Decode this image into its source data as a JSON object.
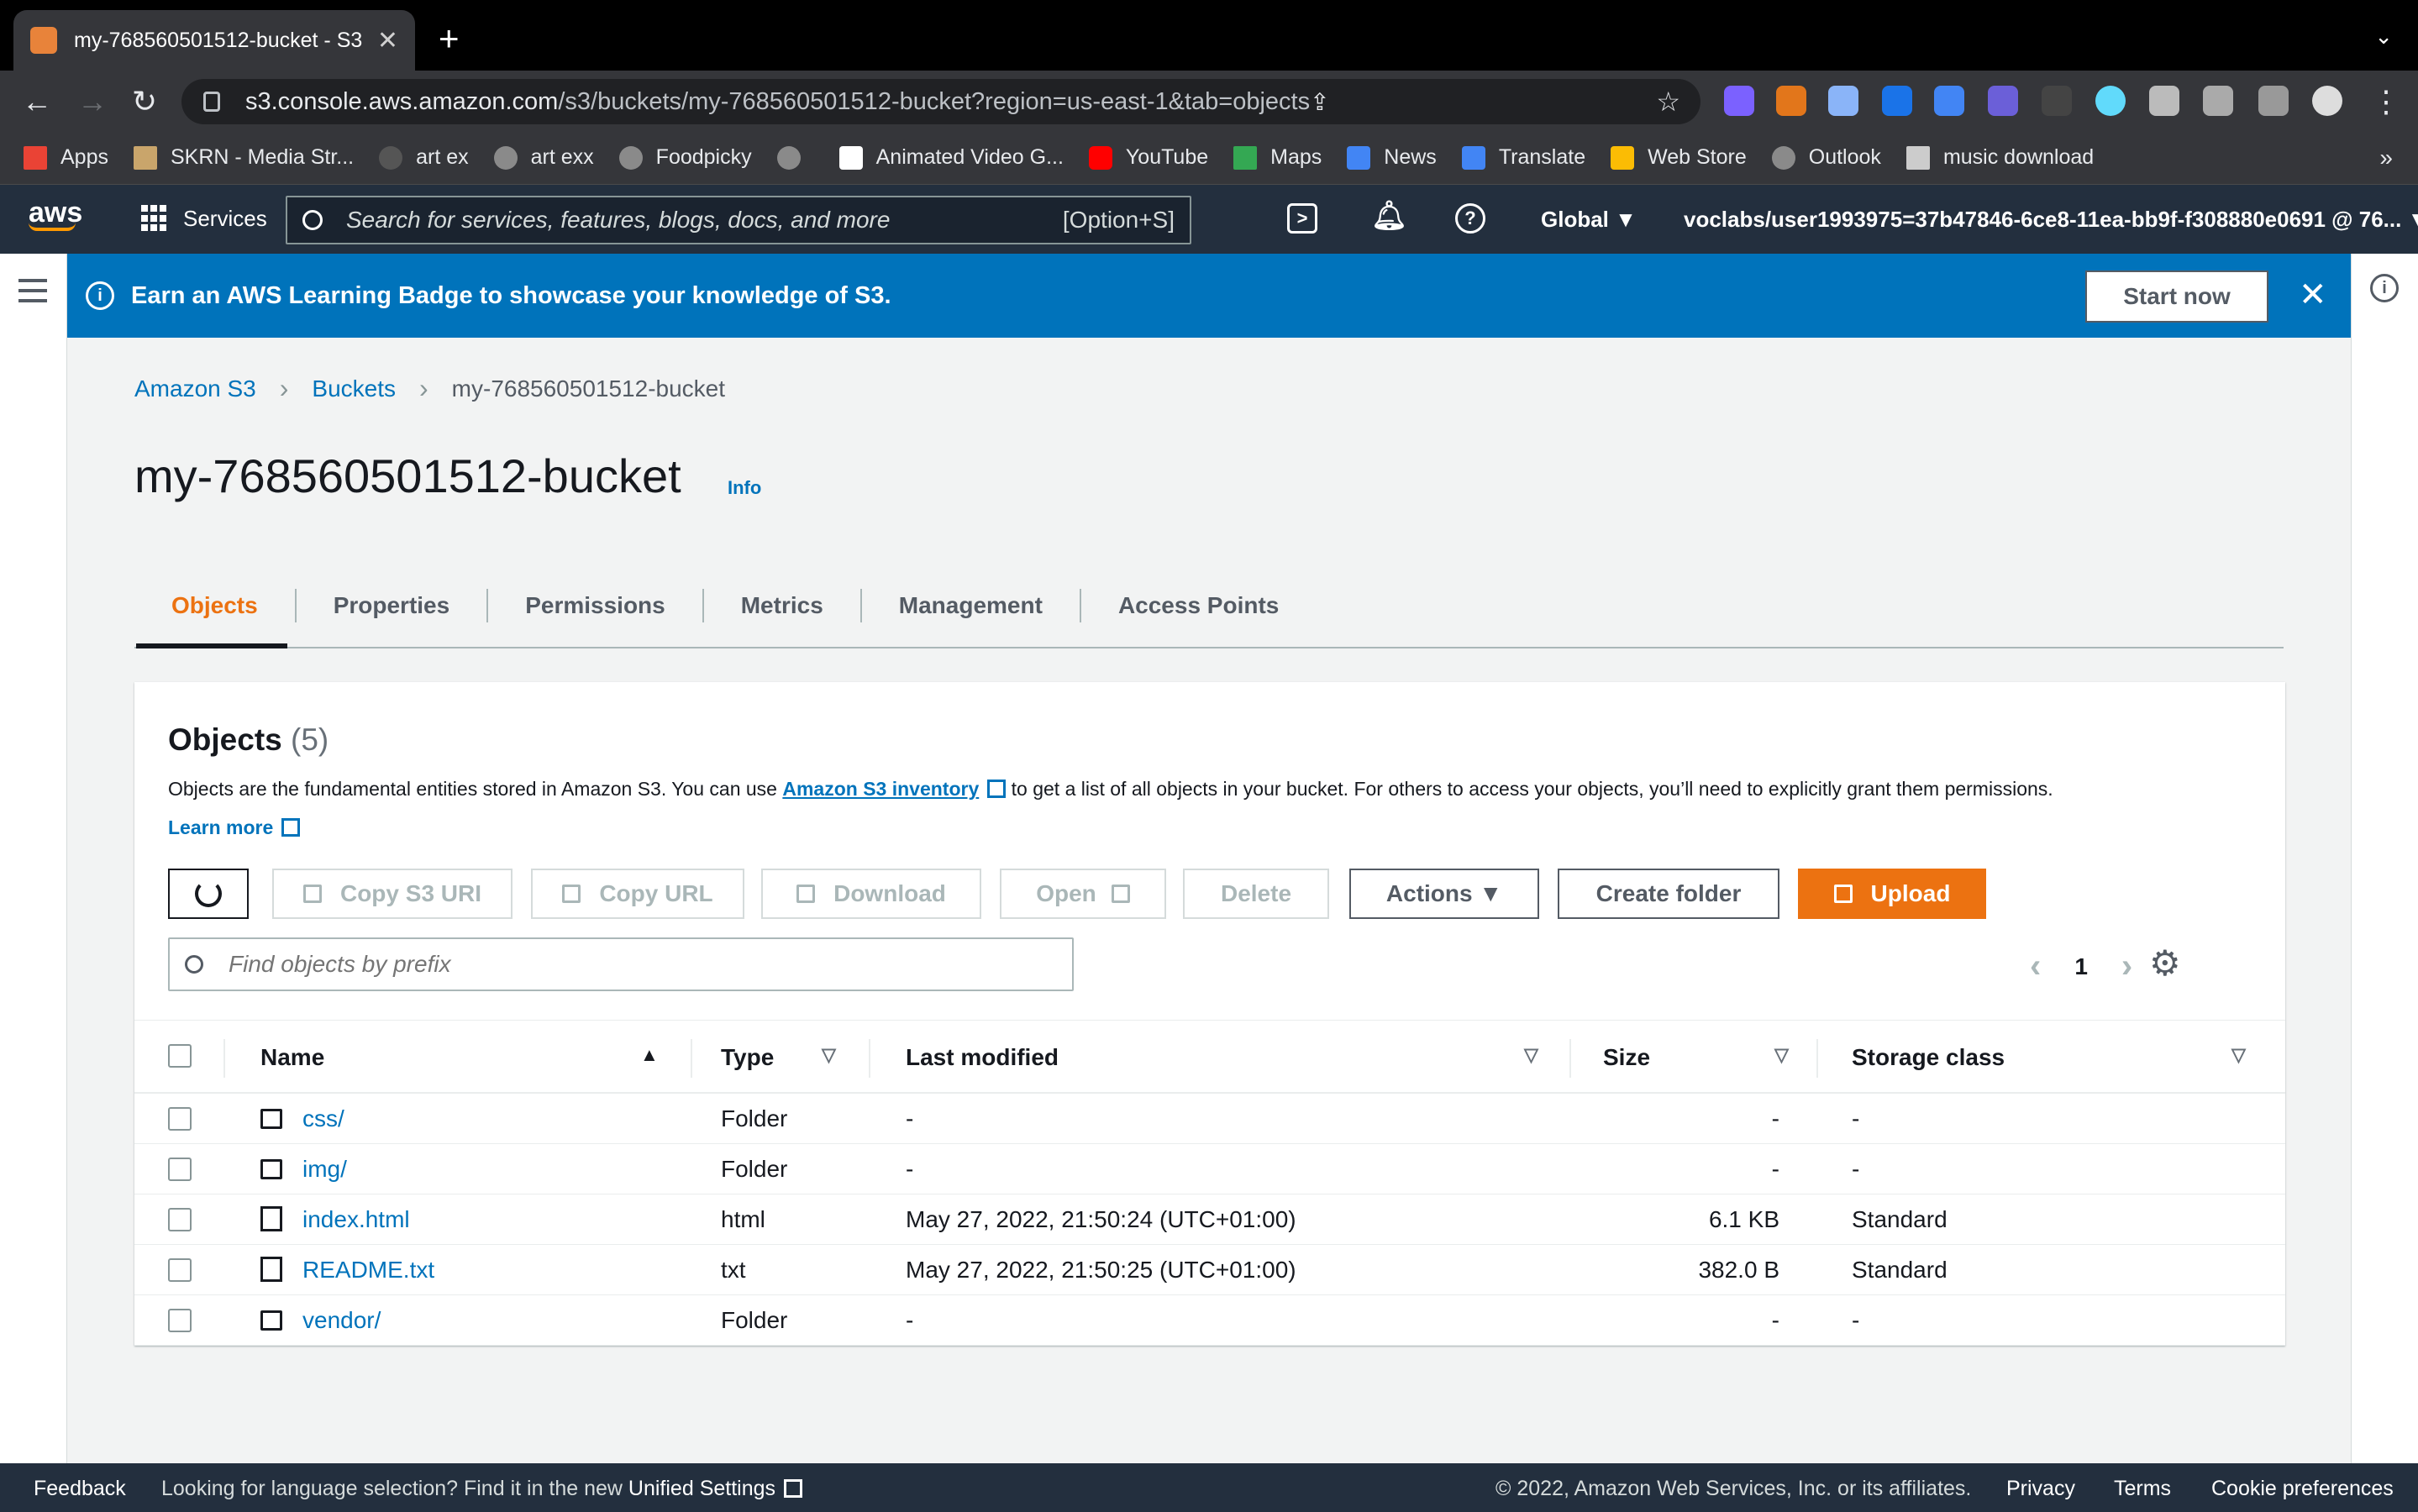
{
  "browser": {
    "tab_title": "my-768560501512-bucket - S3",
    "url_host": "s3.console.aws.amazon.com",
    "url_path": "/s3/buckets/my-768560501512-bucket?region=us-east-1&tab=objects",
    "bookmarks": [
      "Apps",
      "SKRN - Media Str...",
      "art ex",
      "art exx",
      "Foodpicky",
      "",
      "Animated Video G...",
      "YouTube",
      "Maps",
      "News",
      "Translate",
      "Web Store",
      "Outlook",
      "music download"
    ],
    "bookmarks_more": "»"
  },
  "aws_header": {
    "logo": "aws",
    "services": "Services",
    "search_placeholder": "Search for services, features, blogs, docs, and more",
    "search_shortcut": "[Option+S]",
    "region": "Global ▼",
    "account": "voclabs/user1993975=37b47846-6ce8-11ea-bb9f-f308880e0691 @ 76... ▼"
  },
  "banner": {
    "message": "Earn an AWS Learning Badge to showcase your knowledge of S3.",
    "button": "Start now",
    "close": "✕"
  },
  "breadcrumb": [
    "Amazon S3",
    "Buckets",
    "my-768560501512-bucket"
  ],
  "page": {
    "title": "my-768560501512-bucket",
    "info": "Info"
  },
  "tabs": [
    "Objects",
    "Properties",
    "Permissions",
    "Metrics",
    "Management",
    "Access Points"
  ],
  "objects": {
    "heading": "Objects",
    "count": "(5)",
    "desc_before": "Objects are the fundamental entities stored in Amazon S3. You can use ",
    "desc_link": "Amazon S3 inventory",
    "desc_after": " to get a list of all objects in your bucket. For others to access your objects, you’ll need to explicitly grant them permissions.",
    "learn_more": "Learn more",
    "buttons": {
      "copy_uri": "Copy S3 URI",
      "copy_url": "Copy URL",
      "download": "Download",
      "open": "Open",
      "delete": "Delete",
      "actions": "Actions ▼",
      "create_folder": "Create folder",
      "upload": "Upload"
    },
    "find_placeholder": "Find objects by prefix",
    "page_number": "1",
    "columns": [
      "Name",
      "Type",
      "Last modified",
      "Size",
      "Storage class"
    ],
    "rows": [
      {
        "name": "css/",
        "type": "Folder",
        "modified": "-",
        "size": "-",
        "storage": "-",
        "kind": "folder"
      },
      {
        "name": "img/",
        "type": "Folder",
        "modified": "-",
        "size": "-",
        "storage": "-",
        "kind": "folder"
      },
      {
        "name": "index.html",
        "type": "html",
        "modified": "May 27, 2022, 21:50:24 (UTC+01:00)",
        "size": "6.1 KB",
        "storage": "Standard",
        "kind": "file"
      },
      {
        "name": "README.txt",
        "type": "txt",
        "modified": "May 27, 2022, 21:50:25 (UTC+01:00)",
        "size": "382.0 B",
        "storage": "Standard",
        "kind": "file"
      },
      {
        "name": "vendor/",
        "type": "Folder",
        "modified": "-",
        "size": "-",
        "storage": "-",
        "kind": "folder"
      }
    ]
  },
  "footer": {
    "feedback": "Feedback",
    "lang_text": "Looking for language selection? Find it in the new ",
    "lang_link": "Unified Settings",
    "copyright": "© 2022, Amazon Web Services, Inc. or its affiliates.",
    "privacy": "Privacy",
    "terms": "Terms",
    "cookies": "Cookie preferences"
  },
  "colors": {
    "aws_nav": "#232f3e",
    "banner": "#0073bb",
    "accent": "#ec7211",
    "link": "#0073bb"
  }
}
